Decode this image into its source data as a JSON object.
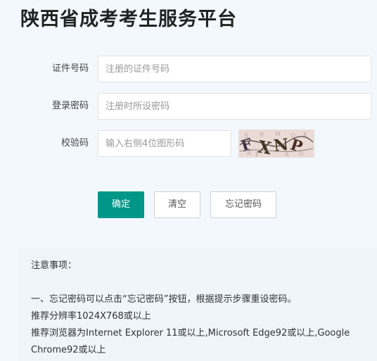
{
  "title": "陕西省成考考生服务平台",
  "form": {
    "id_number": {
      "label": "证件号码",
      "placeholder": "注册的证件号码",
      "value": ""
    },
    "password": {
      "label": "登录密码",
      "placeholder": "注册时所设密码",
      "value": ""
    },
    "captcha": {
      "label": "校验码",
      "placeholder": "输入右侧4位图形码",
      "value": "",
      "image_text": "FXNP"
    }
  },
  "buttons": {
    "confirm": "确定",
    "clear": "清空",
    "forgot_password": "忘记密码"
  },
  "notice": {
    "heading": "注意事项：",
    "lines": [
      "一、忘记密码可以点击“忘记密码”按钮，根据提示步骤重设密码。",
      "推荐分辨率1024X768或以上",
      "推荐浏览器为Internet Explorer 11或以上,Microsoft Edge92或以上,Google Chrome92或以上"
    ]
  },
  "colors": {
    "primary": "#009688",
    "background": "#f2f8fd"
  }
}
